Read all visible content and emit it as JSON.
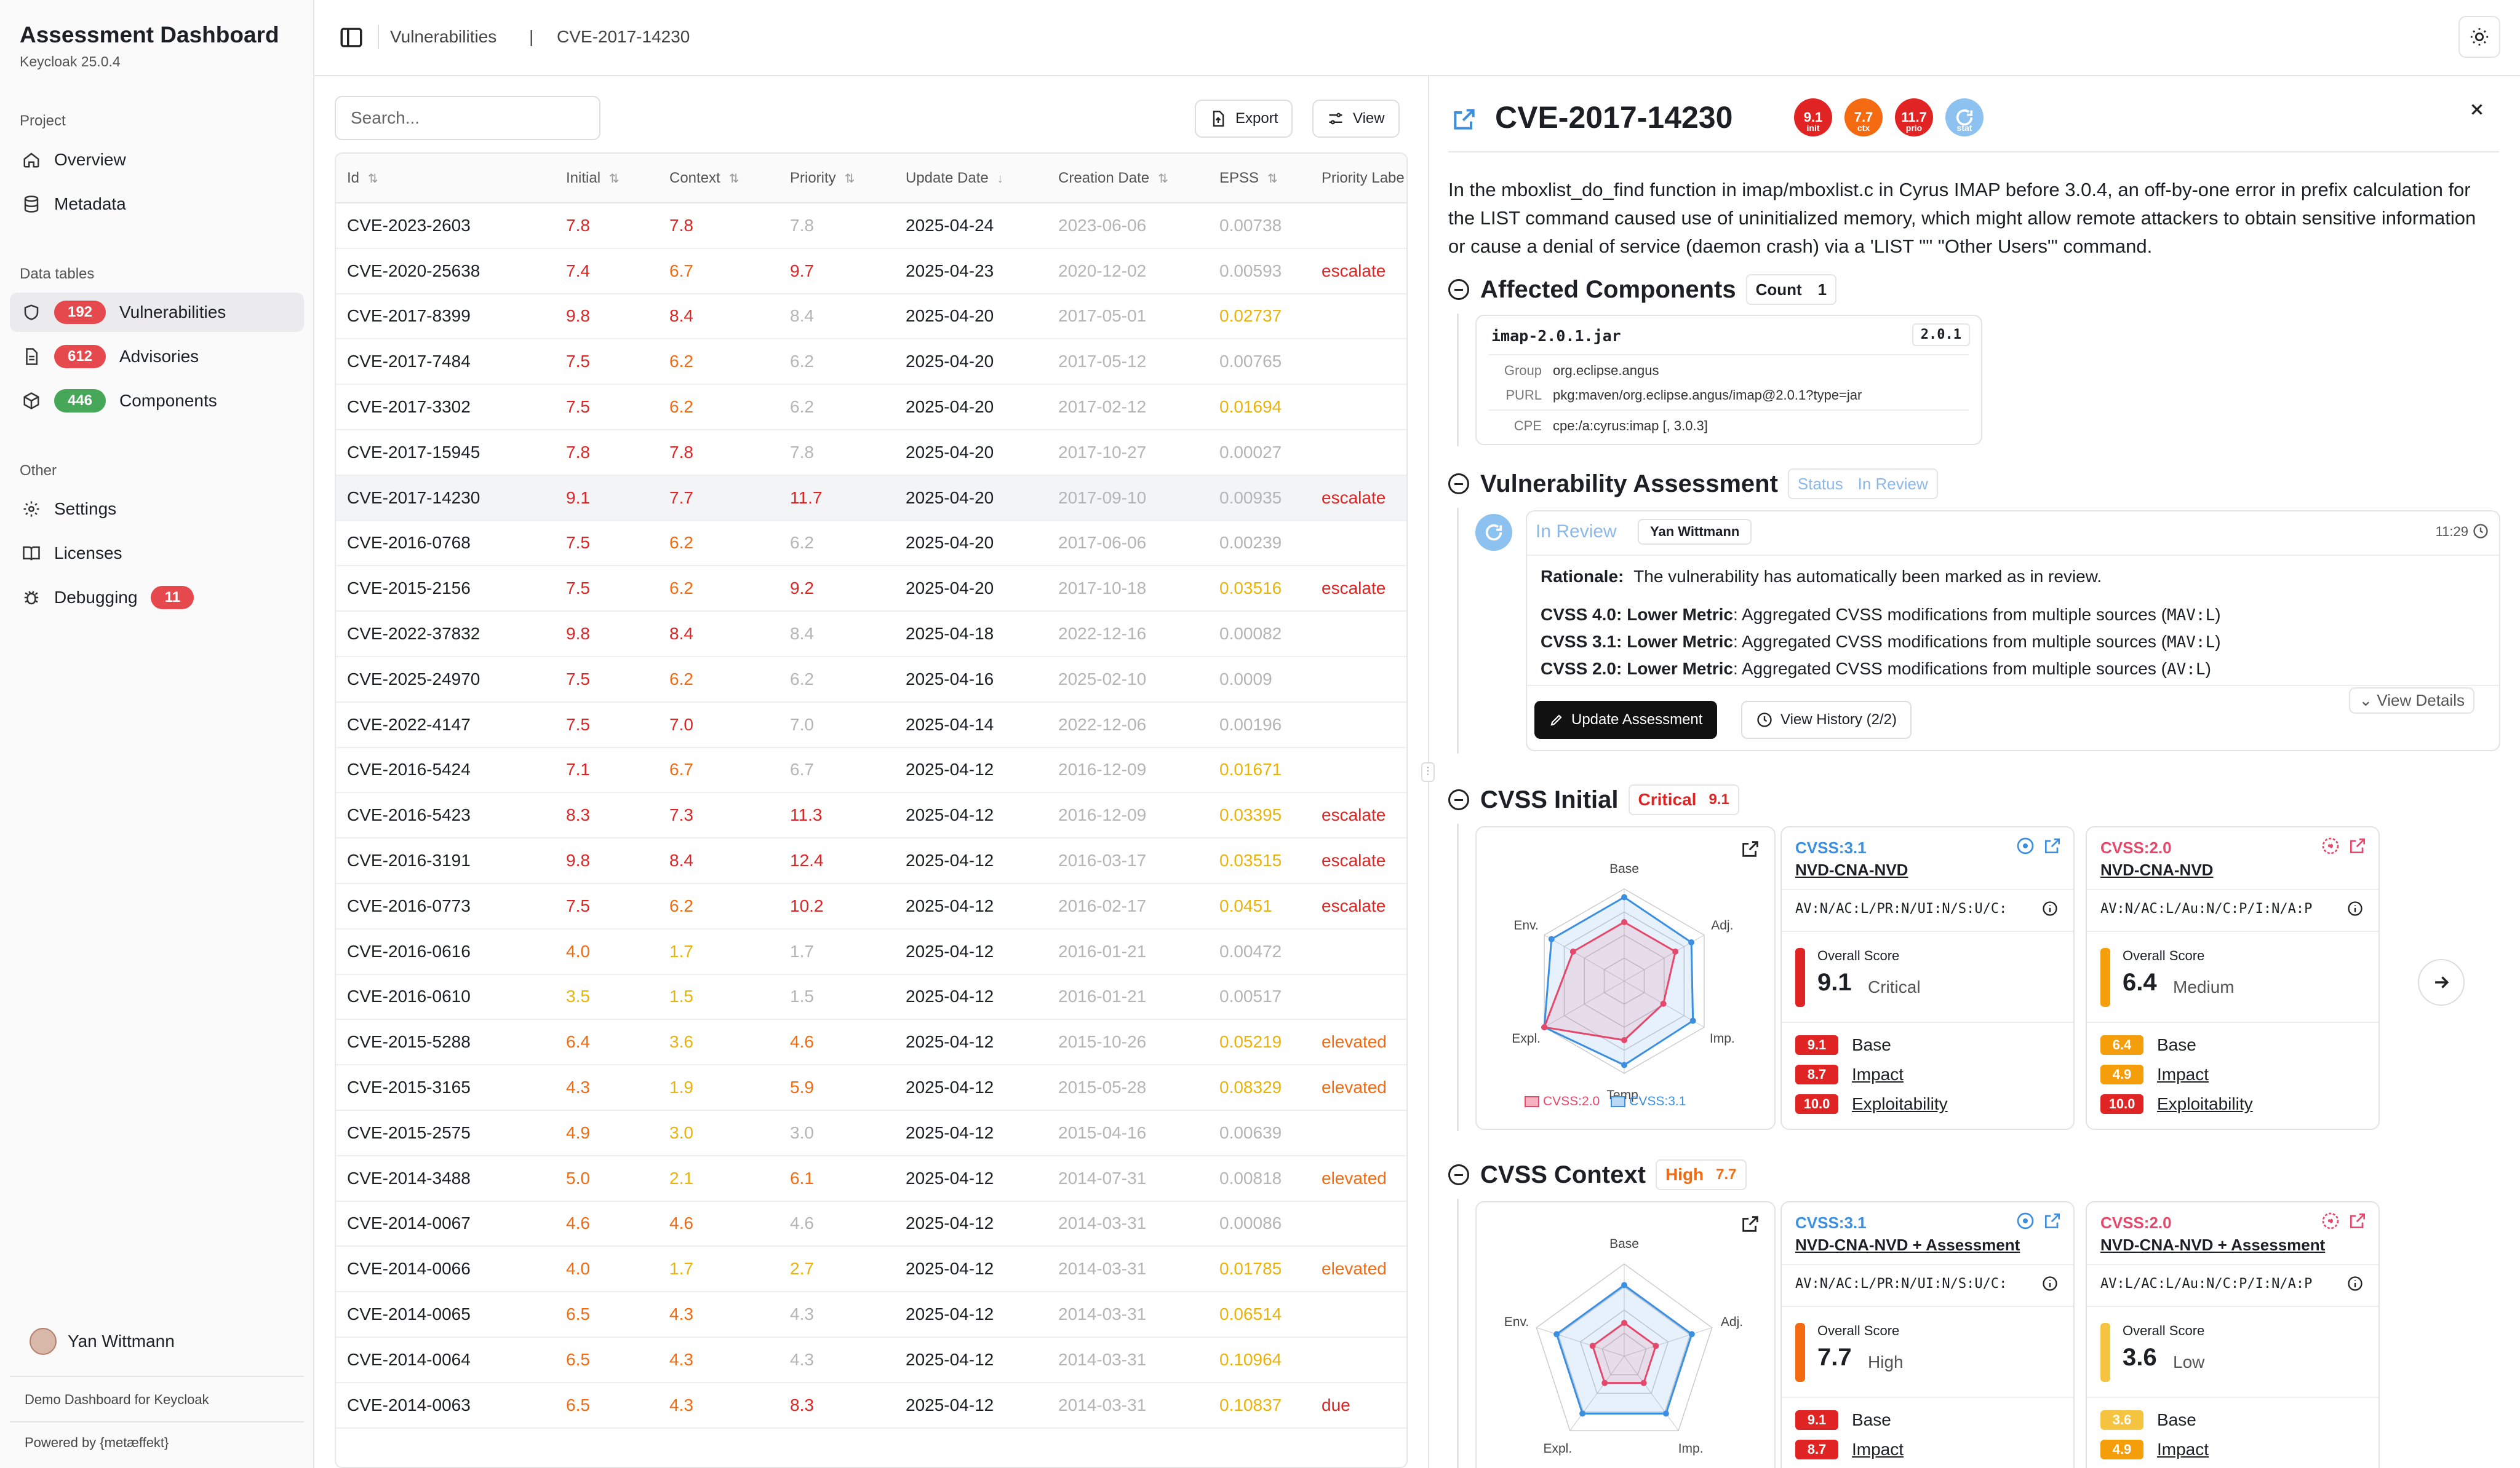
{
  "app": {
    "title": "Assessment Dashboard",
    "subtitle": "Keycloak 25.0.4"
  },
  "sidebar": {
    "project_label": "Project",
    "project_items": [
      {
        "label": "Overview"
      },
      {
        "label": "Metadata"
      }
    ],
    "data_label": "Data tables",
    "data_items": [
      {
        "label": "Vulnerabilities",
        "count": "192",
        "color": "#e5484d"
      },
      {
        "label": "Advisories",
        "count": "612",
        "color": "#e5484d"
      },
      {
        "label": "Components",
        "count": "446",
        "color": "#46a758"
      }
    ],
    "other_label": "Other",
    "other_items": [
      {
        "label": "Settings"
      },
      {
        "label": "Licenses"
      },
      {
        "label": "Debugging",
        "count": "11"
      }
    ],
    "user": "Yan Wittmann",
    "footer1": "Demo Dashboard for Keycloak",
    "footer2": "Powered by {metæffekt}"
  },
  "breadcrumb": {
    "first": "Vulnerabilities",
    "sep": "|",
    "second": "CVE-2017-14230"
  },
  "toolbar": {
    "search_placeholder": "Search...",
    "export_label": "Export",
    "view_label": "View"
  },
  "table": {
    "headers": [
      "Id",
      "Initial",
      "Context",
      "Priority",
      "Update Date",
      "Creation Date",
      "EPSS",
      "Priority Labe"
    ],
    "rows": [
      {
        "id": "CVE-2023-2603",
        "initial": "7.8",
        "context": "7.8",
        "priority": "7.8",
        "update": "2025-04-24",
        "created": "2023-06-06",
        "epss": "0.00738",
        "label": ""
      },
      {
        "id": "CVE-2020-25638",
        "initial": "7.4",
        "context": "6.7",
        "priority": "9.7",
        "update": "2025-04-23",
        "created": "2020-12-02",
        "epss": "0.00593",
        "label": "escalate"
      },
      {
        "id": "CVE-2017-8399",
        "initial": "9.8",
        "context": "8.4",
        "priority": "8.4",
        "update": "2025-04-20",
        "created": "2017-05-01",
        "epss": "0.02737",
        "label": ""
      },
      {
        "id": "CVE-2017-7484",
        "initial": "7.5",
        "context": "6.2",
        "priority": "6.2",
        "update": "2025-04-20",
        "created": "2017-05-12",
        "epss": "0.00765",
        "label": ""
      },
      {
        "id": "CVE-2017-3302",
        "initial": "7.5",
        "context": "6.2",
        "priority": "6.2",
        "update": "2025-04-20",
        "created": "2017-02-12",
        "epss": "0.01694",
        "label": ""
      },
      {
        "id": "CVE-2017-15945",
        "initial": "7.8",
        "context": "7.8",
        "priority": "7.8",
        "update": "2025-04-20",
        "created": "2017-10-27",
        "epss": "0.00027",
        "label": ""
      },
      {
        "id": "CVE-2017-14230",
        "initial": "9.1",
        "context": "7.7",
        "priority": "11.7",
        "update": "2025-04-20",
        "created": "2017-09-10",
        "epss": "0.00935",
        "label": "escalate"
      },
      {
        "id": "CVE-2016-0768",
        "initial": "7.5",
        "context": "6.2",
        "priority": "6.2",
        "update": "2025-04-20",
        "created": "2017-06-06",
        "epss": "0.00239",
        "label": ""
      },
      {
        "id": "CVE-2015-2156",
        "initial": "7.5",
        "context": "6.2",
        "priority": "9.2",
        "update": "2025-04-20",
        "created": "2017-10-18",
        "epss": "0.03516",
        "label": "escalate"
      },
      {
        "id": "CVE-2022-37832",
        "initial": "9.8",
        "context": "8.4",
        "priority": "8.4",
        "update": "2025-04-18",
        "created": "2022-12-16",
        "epss": "0.00082",
        "label": ""
      },
      {
        "id": "CVE-2025-24970",
        "initial": "7.5",
        "context": "6.2",
        "priority": "6.2",
        "update": "2025-04-16",
        "created": "2025-02-10",
        "epss": "0.0009",
        "label": ""
      },
      {
        "id": "CVE-2022-4147",
        "initial": "7.5",
        "context": "7.0",
        "priority": "7.0",
        "update": "2025-04-14",
        "created": "2022-12-06",
        "epss": "0.00196",
        "label": ""
      },
      {
        "id": "CVE-2016-5424",
        "initial": "7.1",
        "context": "6.7",
        "priority": "6.7",
        "update": "2025-04-12",
        "created": "2016-12-09",
        "epss": "0.01671",
        "label": ""
      },
      {
        "id": "CVE-2016-5423",
        "initial": "8.3",
        "context": "7.3",
        "priority": "11.3",
        "update": "2025-04-12",
        "created": "2016-12-09",
        "epss": "0.03395",
        "label": "escalate"
      },
      {
        "id": "CVE-2016-3191",
        "initial": "9.8",
        "context": "8.4",
        "priority": "12.4",
        "update": "2025-04-12",
        "created": "2016-03-17",
        "epss": "0.03515",
        "label": "escalate"
      },
      {
        "id": "CVE-2016-0773",
        "initial": "7.5",
        "context": "6.2",
        "priority": "10.2",
        "update": "2025-04-12",
        "created": "2016-02-17",
        "epss": "0.0451",
        "label": "escalate"
      },
      {
        "id": "CVE-2016-0616",
        "initial": "4.0",
        "context": "1.7",
        "priority": "1.7",
        "update": "2025-04-12",
        "created": "2016-01-21",
        "epss": "0.00472",
        "label": ""
      },
      {
        "id": "CVE-2016-0610",
        "initial": "3.5",
        "context": "1.5",
        "priority": "1.5",
        "update": "2025-04-12",
        "created": "2016-01-21",
        "epss": "0.00517",
        "label": ""
      },
      {
        "id": "CVE-2015-5288",
        "initial": "6.4",
        "context": "3.6",
        "priority": "4.6",
        "update": "2025-04-12",
        "created": "2015-10-26",
        "epss": "0.05219",
        "label": "elevated"
      },
      {
        "id": "CVE-2015-3165",
        "initial": "4.3",
        "context": "1.9",
        "priority": "5.9",
        "update": "2025-04-12",
        "created": "2015-05-28",
        "epss": "0.08329",
        "label": "elevated"
      },
      {
        "id": "CVE-2015-2575",
        "initial": "4.9",
        "context": "3.0",
        "priority": "3.0",
        "update": "2025-04-12",
        "created": "2015-04-16",
        "epss": "0.00639",
        "label": ""
      },
      {
        "id": "CVE-2014-3488",
        "initial": "5.0",
        "context": "2.1",
        "priority": "6.1",
        "update": "2025-04-12",
        "created": "2014-07-31",
        "epss": "0.00818",
        "label": "elevated"
      },
      {
        "id": "CVE-2014-0067",
        "initial": "4.6",
        "context": "4.6",
        "priority": "4.6",
        "update": "2025-04-12",
        "created": "2014-03-31",
        "epss": "0.00086",
        "label": ""
      },
      {
        "id": "CVE-2014-0066",
        "initial": "4.0",
        "context": "1.7",
        "priority": "2.7",
        "update": "2025-04-12",
        "created": "2014-03-31",
        "epss": "0.01785",
        "label": "elevated"
      },
      {
        "id": "CVE-2014-0065",
        "initial": "6.5",
        "context": "4.3",
        "priority": "4.3",
        "update": "2025-04-12",
        "created": "2014-03-31",
        "epss": "0.06514",
        "label": ""
      },
      {
        "id": "CVE-2014-0064",
        "initial": "6.5",
        "context": "4.3",
        "priority": "4.3",
        "update": "2025-04-12",
        "created": "2014-03-31",
        "epss": "0.10964",
        "label": ""
      },
      {
        "id": "CVE-2014-0063",
        "initial": "6.5",
        "context": "4.3",
        "priority": "8.3",
        "update": "2025-04-12",
        "created": "2014-03-31",
        "epss": "0.10837",
        "label": "due"
      }
    ]
  },
  "detail": {
    "title": "CVE-2017-14230",
    "scores": [
      {
        "value": "9.1",
        "label": "init",
        "color": "#e02424"
      },
      {
        "value": "7.7",
        "label": "ctx",
        "color": "#f36a10"
      },
      {
        "value": "11.7",
        "label": "prio",
        "color": "#e02424"
      },
      {
        "value": "",
        "label": "stat",
        "color": "#8dc2f0"
      }
    ],
    "description": "In the mboxlist_do_find function in imap/mboxlist.c in Cyrus IMAP before 3.0.4, an off-by-one error in prefix calculation for the LIST command caused use of uninitialized memory, which might allow remote attackers to obtain sensitive information or cause a denial of service (daemon crash) via a 'LIST \"\" \"Other Users\"' command.",
    "affected": {
      "title": "Affected Components",
      "count_label": "Count",
      "count": "1",
      "artifact": "imap-2.0.1.jar",
      "version": "2.0.1",
      "group_label": "Group",
      "group": "org.eclipse.angus",
      "purl_label": "PURL",
      "purl": "pkg:maven/org.eclipse.angus/imap@2.0.1?type=jar",
      "cpe_label": "CPE",
      "cpe": "cpe:/a:cyrus:imap [, 3.0.3]"
    },
    "assessment": {
      "title": "Vulnerability Assessment",
      "status_label": "Status",
      "status": "In Review",
      "entry_status": "In Review",
      "author": "Yan Wittmann",
      "time": "11:29",
      "rationale_label": "Rationale:",
      "rationale": "The vulnerability has automatically been marked as in review.",
      "lines": [
        {
          "ver": "CVSS 4.0:",
          "metric": "Lower Metric",
          "text": ": Aggregated CVSS modifications from multiple sources (",
          "code": "MAV:L",
          "end": ")"
        },
        {
          "ver": "CVSS 3.1:",
          "metric": "Lower Metric",
          "text": ": Aggregated CVSS modifications from multiple sources (",
          "code": "MAV:L",
          "end": ")"
        },
        {
          "ver": "CVSS 2.0:",
          "metric": "Lower Metric",
          "text": ": Aggregated CVSS modifications from multiple sources (",
          "code": "AV:L",
          "end": ")"
        }
      ],
      "update_btn": "Update Assessment",
      "history_btn": "View History (2/2)",
      "details_btn": "View Details"
    },
    "initial": {
      "title": "CVSS Initial",
      "sev": "Critical",
      "score": "9.1",
      "radar": {
        "axes": [
          "Base",
          "Adj.",
          "Imp.",
          "Temp.",
          "Expl.",
          "Env."
        ],
        "legend": [
          "CVSS:2.0",
          "CVSS:3.1"
        ]
      },
      "cards": [
        {
          "version": "CVSS:3.1",
          "source": "NVD-CNA-NVD",
          "vector": "AV:N/AC:L/PR:N/UI:N/S:U/C:",
          "overall_label": "Overall Score",
          "overall": "9.1",
          "sev": "Critical",
          "color": "#e02424",
          "base": "9.1",
          "impact": "8.7",
          "expl": "10.0",
          "colors": [
            "#e02424",
            "#e02424",
            "#e02424"
          ]
        },
        {
          "version": "CVSS:2.0",
          "source": "NVD-CNA-NVD",
          "vector": "AV:N/AC:L/Au:N/C:P/I:N/A:P",
          "overall_label": "Overall Score",
          "overall": "6.4",
          "sev": "Medium",
          "color": "#f59e0b",
          "base": "6.4",
          "impact": "4.9",
          "expl": "10.0",
          "colors": [
            "#f59e0b",
            "#f59e0b",
            "#e02424"
          ]
        }
      ],
      "labels": {
        "base": "Base",
        "impact": "Impact",
        "expl": "Exploitability"
      }
    },
    "context": {
      "title": "CVSS Context",
      "sev": "High",
      "score": "7.7",
      "radar": {
        "axes": [
          "Base",
          "Adj.",
          "Imp.",
          "Expl.",
          "Env."
        ]
      },
      "cards": [
        {
          "version": "CVSS:3.1",
          "source": "NVD-CNA-NVD + Assessment",
          "vector": "AV:N/AC:L/PR:N/UI:N/S:U/C:",
          "overall_label": "Overall Score",
          "overall": "7.7",
          "sev": "High",
          "color": "#f36a10",
          "base": "9.1",
          "impact": "8.7",
          "colors": [
            "#e02424",
            "#e02424"
          ]
        },
        {
          "version": "CVSS:2.0",
          "source": "NVD-CNA-NVD + Assessment",
          "vector": "AV:L/AC:L/Au:N/C:P/I:N/A:P",
          "overall_label": "Overall Score",
          "overall": "3.6",
          "sev": "Low",
          "color": "#f5c542",
          "base": "3.6",
          "impact": "4.9",
          "colors": [
            "#f5c542",
            "#f59e0b"
          ]
        }
      ],
      "labels": {
        "base": "Base",
        "impact": "Impact"
      }
    }
  },
  "colors": {
    "critical": "#e02424",
    "high": "#f36a10",
    "medium": "#f59e0b",
    "low": "#eab308",
    "cvss31": "#3b8fe0",
    "cvss20": "#e5486b"
  }
}
